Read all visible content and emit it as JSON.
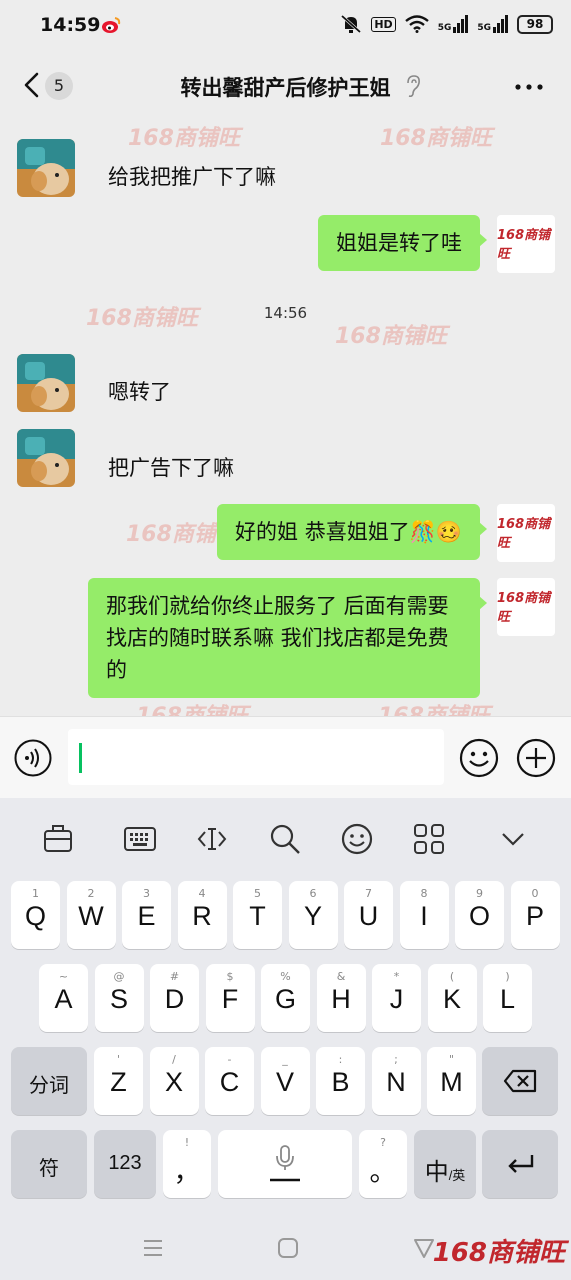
{
  "status": {
    "time": "14:59",
    "hd_label": "HD",
    "signal1": "5G",
    "signal2": "5G",
    "battery": "98"
  },
  "header": {
    "unread_count": "5",
    "title": "转出馨甜产后修护王姐"
  },
  "watermark_text": "168商铺旺",
  "logo_text": "168商铺旺",
  "messages": [
    {
      "side": "in",
      "text": "给我把推广下了嘛"
    },
    {
      "side": "out",
      "text": "姐姐是转了哇"
    },
    {
      "side": "time",
      "text": "14:56"
    },
    {
      "side": "in",
      "text": "嗯转了"
    },
    {
      "side": "in",
      "text": "把广告下了嘛"
    },
    {
      "side": "out",
      "text": "好的姐 恭喜姐姐了🎊🥴"
    },
    {
      "side": "out",
      "text": "那我们就给你终止服务了 后面有需要找店的随时联系嘛 我们找店都是免费的"
    }
  ],
  "keyboard": {
    "row1": [
      {
        "hint": "1",
        "key": "Q"
      },
      {
        "hint": "2",
        "key": "W"
      },
      {
        "hint": "3",
        "key": "E"
      },
      {
        "hint": "4",
        "key": "R"
      },
      {
        "hint": "5",
        "key": "T"
      },
      {
        "hint": "6",
        "key": "Y"
      },
      {
        "hint": "7",
        "key": "U"
      },
      {
        "hint": "8",
        "key": "I"
      },
      {
        "hint": "9",
        "key": "O"
      },
      {
        "hint": "0",
        "key": "P"
      }
    ],
    "row2": [
      {
        "hint": "~",
        "key": "A"
      },
      {
        "hint": "@",
        "key": "S"
      },
      {
        "hint": "#",
        "key": "D"
      },
      {
        "hint": "$",
        "key": "F"
      },
      {
        "hint": "%",
        "key": "G"
      },
      {
        "hint": "&",
        "key": "H"
      },
      {
        "hint": "*",
        "key": "J"
      },
      {
        "hint": "(",
        "key": "K"
      },
      {
        "hint": ")",
        "key": "L"
      }
    ],
    "row3": [
      {
        "hint": "'",
        "key": "Z"
      },
      {
        "hint": "/",
        "key": "X"
      },
      {
        "hint": "-",
        "key": "C"
      },
      {
        "hint": "_",
        "key": "V"
      },
      {
        "hint": ":",
        "key": "B"
      },
      {
        "hint": ";",
        "key": "N"
      },
      {
        "hint": "\"",
        "key": "M"
      }
    ],
    "segment_label": "分词",
    "symbol_label": "符",
    "number_label": "123",
    "punct_top": "!",
    "punct_main": "，",
    "punct2_top": "?",
    "punct2_main": "。",
    "lang_main": "中",
    "lang_sub": "/英"
  },
  "corner_logo": "168商铺旺"
}
